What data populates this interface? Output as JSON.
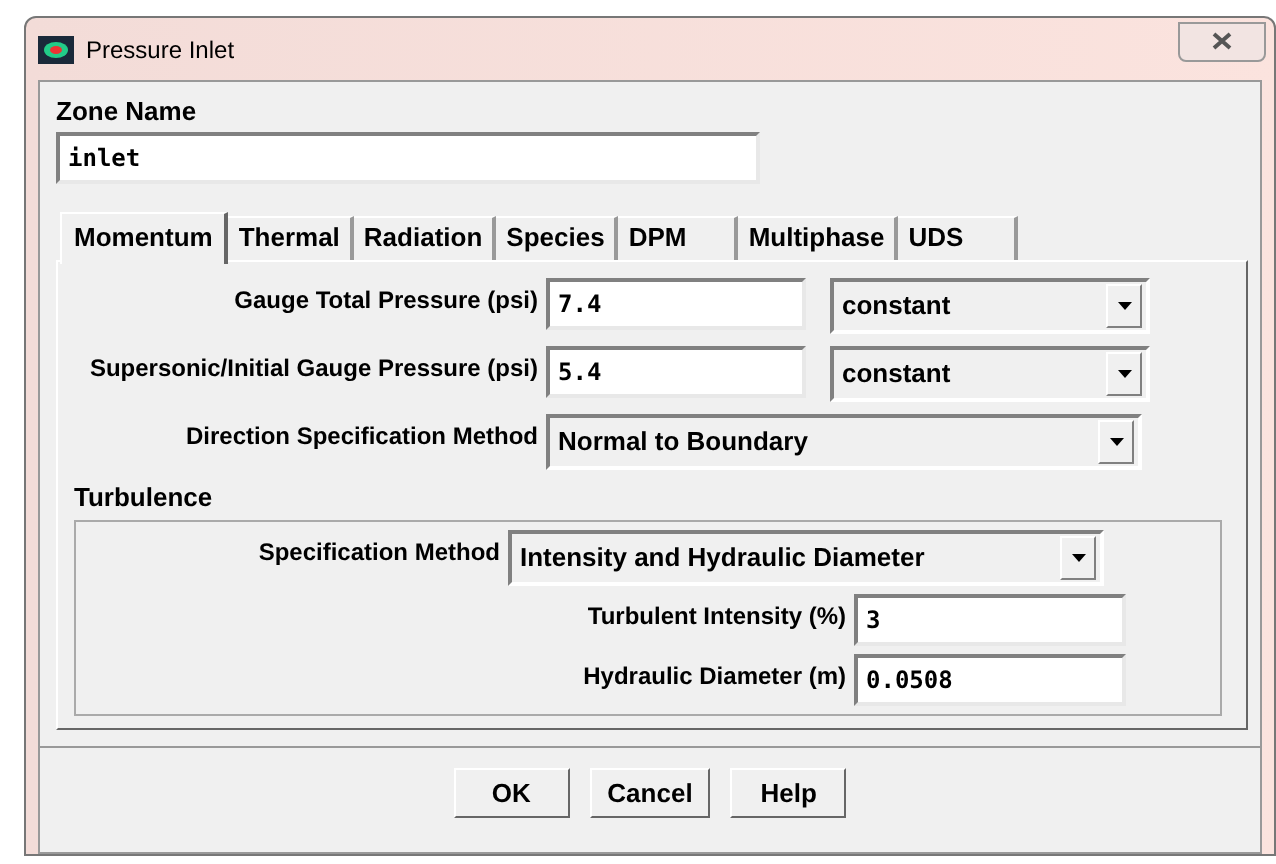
{
  "window": {
    "title": "Pressure Inlet"
  },
  "zone_name": {
    "label": "Zone Name",
    "value": "inlet"
  },
  "tabs": [
    {
      "label": "Momentum",
      "selected": true
    },
    {
      "label": "Thermal",
      "selected": false
    },
    {
      "label": "Radiation",
      "selected": false
    },
    {
      "label": "Species",
      "selected": false
    },
    {
      "label": "DPM",
      "selected": false
    },
    {
      "label": "Multiphase",
      "selected": false
    },
    {
      "label": "UDS",
      "selected": false
    }
  ],
  "momentum_fields": [
    {
      "kind": "input_dropdown",
      "label": "Gauge Total Pressure (psi)",
      "value": "7.4",
      "option": "constant"
    },
    {
      "kind": "input_dropdown",
      "label": "Supersonic/Initial Gauge Pressure (psi)",
      "value": "5.4",
      "option": "constant"
    },
    {
      "kind": "dropdown",
      "label": "Direction Specification Method",
      "option": "Normal to Boundary"
    }
  ],
  "turbulence": {
    "title": "Turbulence",
    "fields": [
      {
        "kind": "dropdown",
        "label": "Specification Method",
        "option": "Intensity and Hydraulic Diameter"
      },
      {
        "kind": "input",
        "label": "Turbulent Intensity (%)",
        "value": "3"
      },
      {
        "kind": "input",
        "label": "Hydraulic Diameter (m)",
        "value": "0.0508"
      }
    ]
  },
  "buttons": [
    "OK",
    "Cancel",
    "Help"
  ]
}
